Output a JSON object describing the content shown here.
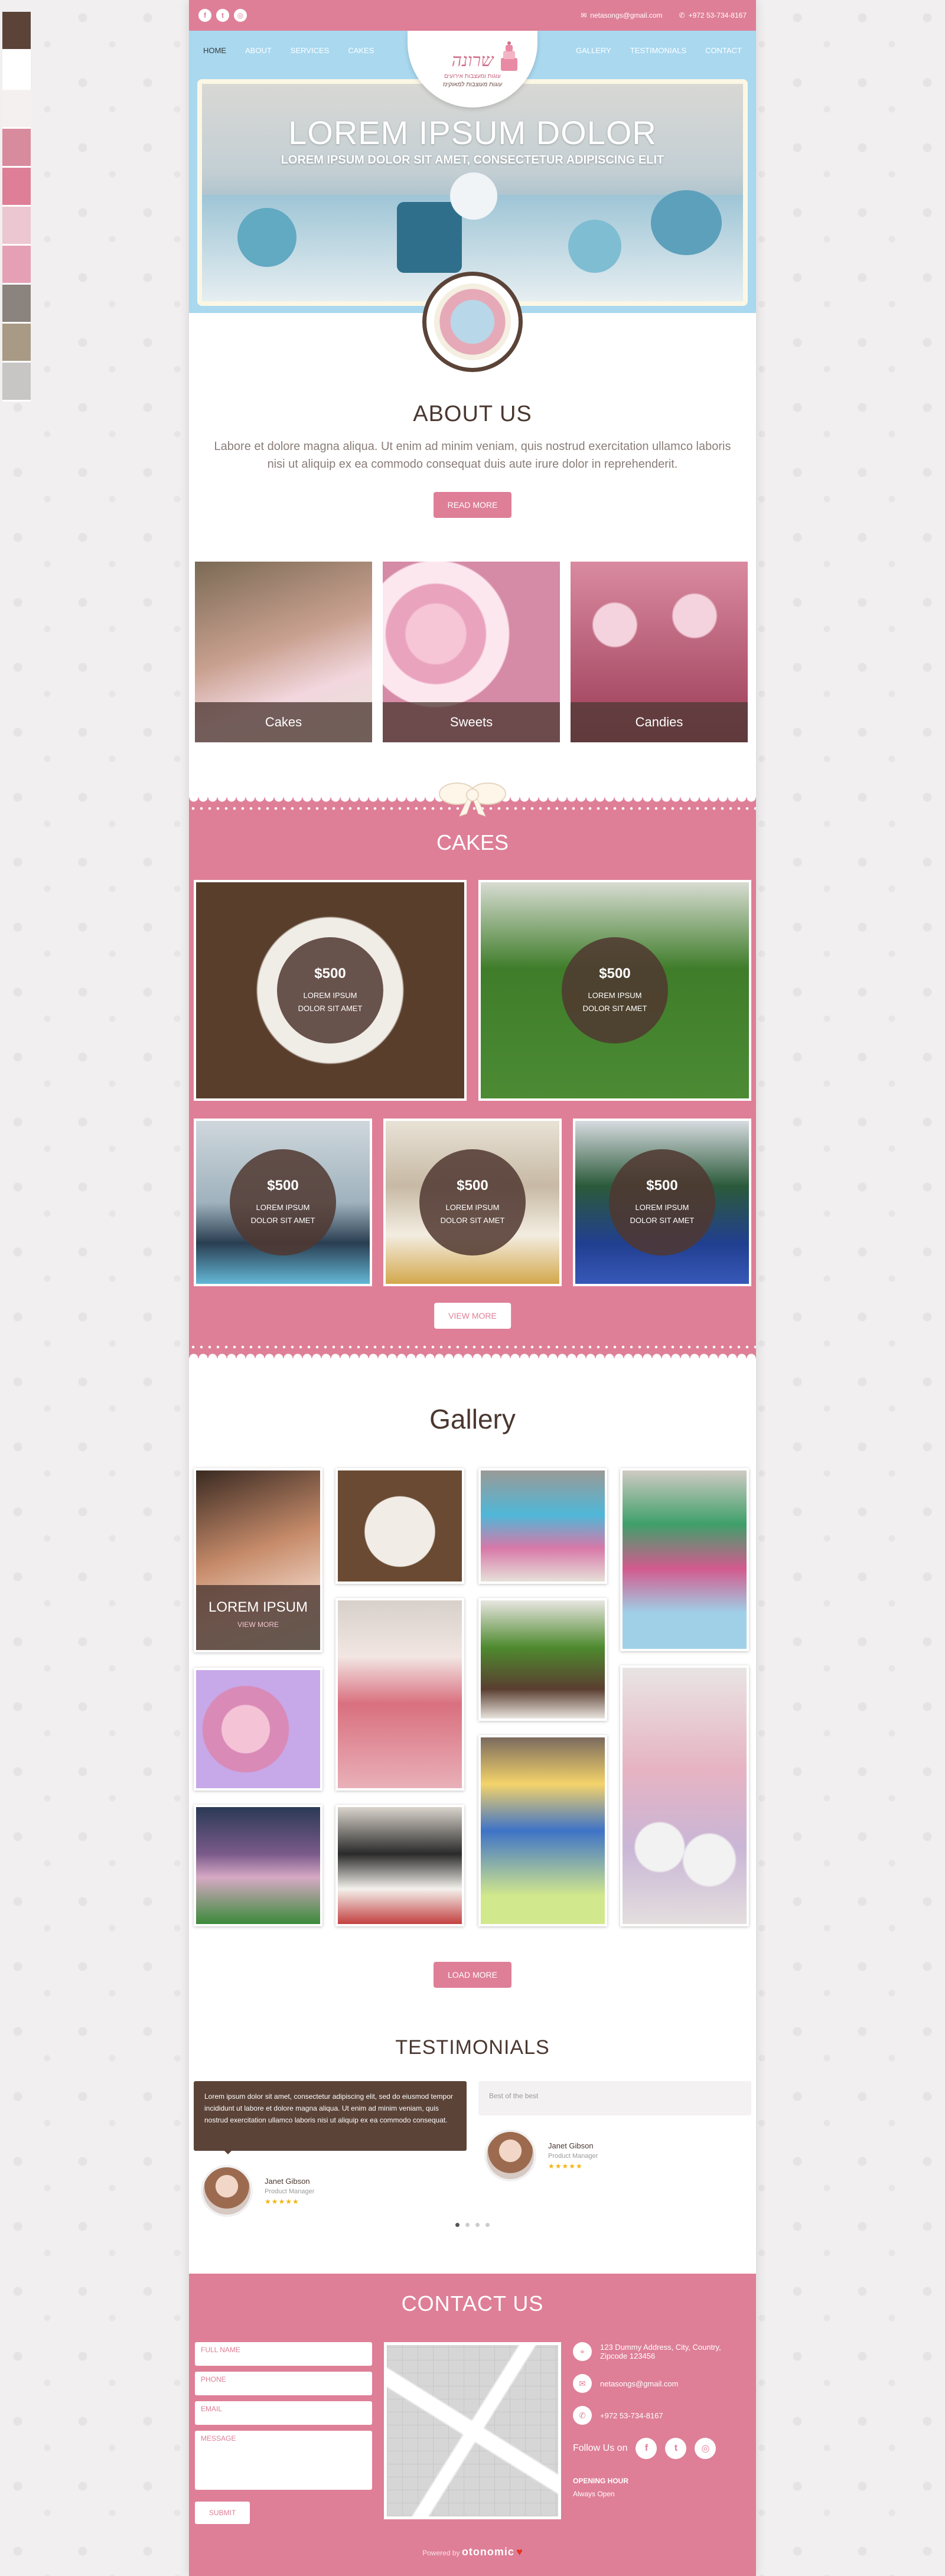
{
  "swatches": [
    "#5b4338",
    "#ffffff",
    "#f5f0f0",
    "#d98b9e",
    "#de7f97",
    "#ecc6d0",
    "#e6a0b6",
    "#8b837d",
    "#a89a84",
    "#c8c6c4"
  ],
  "topbar": {
    "email": "netasongs@gmail.com",
    "phone": "+972 53-734-8167"
  },
  "nav": {
    "left": [
      "HOME",
      "ABOUT",
      "SERVICES",
      "CAKES"
    ],
    "right": [
      "GALLERY",
      "TESTIMONIALS",
      "CONTACT"
    ]
  },
  "logo": {
    "title": "שרונה",
    "sub1": "עוגות ומעצבות אירועים",
    "sub2": "עוגות מעוצבות למאוקינז"
  },
  "hero": {
    "title": "LOREM IPSUM DOLOR",
    "subtitle": "LOREM IPSUM DOLOR SIT AMET, CONSECTETUR ADIPISCING ELIT"
  },
  "about": {
    "title": "ABOUT US",
    "text": "Labore et dolore magna aliqua. Ut enim ad minim veniam, quis nostrud exercitation ullamco laboris nisi ut aliquip ex ea commodo consequat duis aute irure dolor in reprehenderit.",
    "button": "READ MORE"
  },
  "categories": [
    {
      "label": "Cakes",
      "color": "#c9a08f"
    },
    {
      "label": "Sweets",
      "color": "#e9a3bd"
    },
    {
      "label": "Candies",
      "color": "#c86a82"
    }
  ],
  "cakes": {
    "title": "CAKES",
    "items": [
      {
        "price": "$500",
        "desc": "LOREM IPSUM DOLOR SIT AMET"
      },
      {
        "price": "$500",
        "desc": "LOREM IPSUM DOLOR SIT AMET"
      },
      {
        "price": "$500",
        "desc": "LOREM IPSUM DOLOR SIT AMET"
      },
      {
        "price": "$500",
        "desc": "LOREM IPSUM DOLOR SIT AMET"
      },
      {
        "price": "$500",
        "desc": "LOREM IPSUM DOLOR SIT AMET"
      }
    ],
    "button": "VIEW MORE"
  },
  "gallery": {
    "title": "Gallery",
    "overlay_title": "LOREM IPSUM",
    "overlay_link": "VIEW MORE",
    "button": "LOAD MORE"
  },
  "testimonials": {
    "title": "TESTIMONIALS",
    "quote1": "Lorem ipsum dolor sit amet, consectetur adipiscing elit, sed do eiusmod tempor incididunt ut labore et dolore magna aliqua. Ut enim ad minim veniam, quis nostrud exercitation ullamco laboris nisi ut aliquip ex ea commodo consequat.",
    "quote2": "Best of the best",
    "person1": {
      "name": "Janet Gibson",
      "role": "Product Manager",
      "stars": "★★★★★"
    },
    "person2": {
      "name": "Janet Gibson",
      "role": "Product Manager",
      "stars": "★★★★★"
    }
  },
  "contact": {
    "title": "CONTACT US",
    "fields": [
      "FULL NAME",
      "PHONE",
      "EMAIL",
      "MESSAGE"
    ],
    "submit": "SUBMIT",
    "address": "123 Dummy Address, City, Country, Zipcode 123456",
    "email": "netasongs@gmail.com",
    "phone": "+972 53-734-8167",
    "follow": "Follow Us on",
    "hours_label": "OPENING HOUR",
    "hours_value": "Always Open",
    "powered_prefix": "Powered by",
    "powered_brand": "otonomic"
  }
}
